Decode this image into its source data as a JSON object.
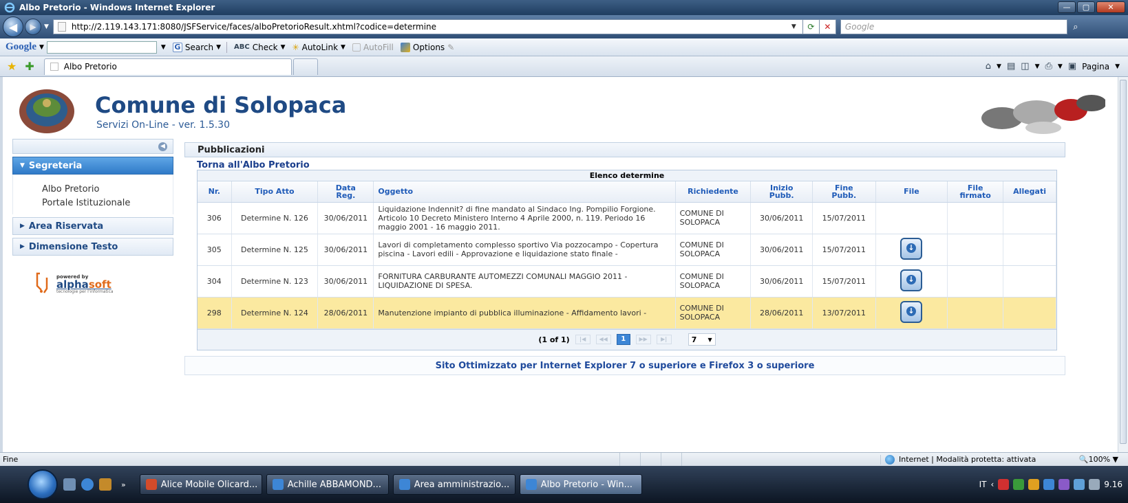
{
  "window": {
    "title": "Albo Pretorio - Windows Internet Explorer",
    "min_label": "—",
    "max_label": "▢",
    "close_label": "✕"
  },
  "address": {
    "url": "http://2.119.143.171:8080/JSFService/faces/alboPretorioResult.xhtml?codice=determine",
    "search_placeholder": "Google"
  },
  "google_toolbar": {
    "logo": "Google",
    "search": "Search",
    "check": "Check",
    "autolink": "AutoLink",
    "autofill": "AutoFill",
    "options": "Options"
  },
  "tabs": {
    "active_label": "Albo Pretorio",
    "page_menu": "Pagina"
  },
  "site": {
    "title": "Comune di Solopaca",
    "subtitle": "Servizi On-Line - ver. 1.5.30"
  },
  "sidebar": {
    "sections": [
      {
        "label": "Segreteria",
        "items": [
          "Albo Pretorio",
          "Portale Istituzionale"
        ]
      },
      {
        "label": "Area Riservata"
      },
      {
        "label": "Dimensione Testo"
      }
    ],
    "powered": {
      "small": "powered by",
      "brand_a": "alpha",
      "brand_b": "soft",
      "tagline": "tecnologie per l'informatica"
    }
  },
  "main": {
    "header": "Pubblicazioni",
    "back_link": "Torna all'Albo Pretorio",
    "table_caption": "Elenco determine",
    "columns": {
      "nr": "Nr.",
      "tipo": "Tipo Atto",
      "data_a": "Data",
      "data_b": "Reg.",
      "oggetto": "Oggetto",
      "richiedente": "Richiedente",
      "inizio_a": "Inizio",
      "inizio_b": "Pubb.",
      "fine_a": "Fine",
      "fine_b": "Pubb.",
      "file": "File",
      "firmato_a": "File",
      "firmato_b": "firmato",
      "allegati": "Allegati"
    },
    "rows": [
      {
        "nr": "306",
        "tipo": "Determine N. 126",
        "data": "30/06/2011",
        "oggetto": "Liquidazione Indennit? di fine mandato al Sindaco Ing. Pompilio Forgione. Articolo 10 Decreto Ministero Interno 4 Aprile 2000, n. 119. Periodo 16 maggio 2001 - 16 maggio 2011.",
        "richiedente": "COMUNE DI SOLOPACA",
        "inizio": "30/06/2011",
        "fine": "15/07/2011"
      },
      {
        "nr": "305",
        "tipo": "Determine N. 125",
        "data": "30/06/2011",
        "oggetto": "Lavori di completamento complesso sportivo Via pozzocampo - Copertura piscina - Lavori edili - Approvazione e liquidazione stato finale -",
        "richiedente": "COMUNE DI SOLOPACA",
        "inizio": "30/06/2011",
        "fine": "15/07/2011"
      },
      {
        "nr": "304",
        "tipo": "Determine N. 123",
        "data": "30/06/2011",
        "oggetto": "FORNITURA CARBURANTE AUTOMEZZI COMUNALI MAGGIO 2011 - LIQUIDAZIONE DI SPESA.",
        "richiedente": "COMUNE DI SOLOPACA",
        "inizio": "30/06/2011",
        "fine": "15/07/2011"
      },
      {
        "nr": "298",
        "tipo": "Determine N. 124",
        "data": "28/06/2011",
        "oggetto": "Manutenzione impianto di pubblica illuminazione - Affidamento lavori -",
        "richiedente": "COMUNE DI SOLOPACA",
        "inizio": "28/06/2011",
        "fine": "13/07/2011"
      }
    ],
    "pager": {
      "label": "(1 of 1)",
      "current": "1",
      "page_size": "7"
    },
    "footer_note": "Sito Ottimizzato per Internet Explorer 7 o superiore e Firefox 3 o superiore"
  },
  "status": {
    "text": "Fine",
    "zone": "Internet | Modalità protetta: attivata",
    "zoom": "100%"
  },
  "taskbar": {
    "buttons": [
      "Alice Mobile Olicard...",
      "Achille ABBAMOND...",
      "Area amministrazio...",
      "Albo Pretorio - Win..."
    ],
    "lang": "IT",
    "clock": "9.16"
  }
}
